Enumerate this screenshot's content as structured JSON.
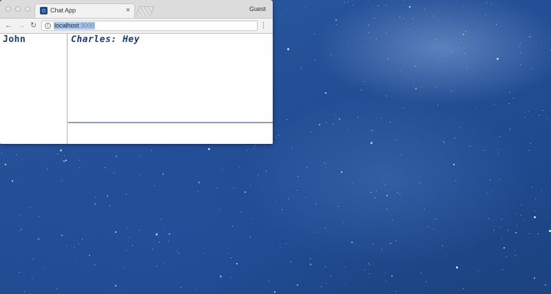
{
  "browser": {
    "tab_title": "Chat App",
    "tab_close_glyph": "×",
    "profile_label": "Guest",
    "url_host": "localhost",
    "url_port": ":3000",
    "icons": [
      "back-icon",
      "forward-icon",
      "reload-icon",
      "info-icon",
      "menu-icon",
      "close-icon",
      "favicon"
    ]
  },
  "chat": {
    "users": [
      "John"
    ],
    "messages": [
      {
        "sender": "Charles",
        "text": "Hey"
      }
    ],
    "compose_value": ""
  },
  "colors": {
    "text": "#1a3a7a",
    "desktop_background": "#244f96",
    "url_selection": "#a8c6f0"
  }
}
